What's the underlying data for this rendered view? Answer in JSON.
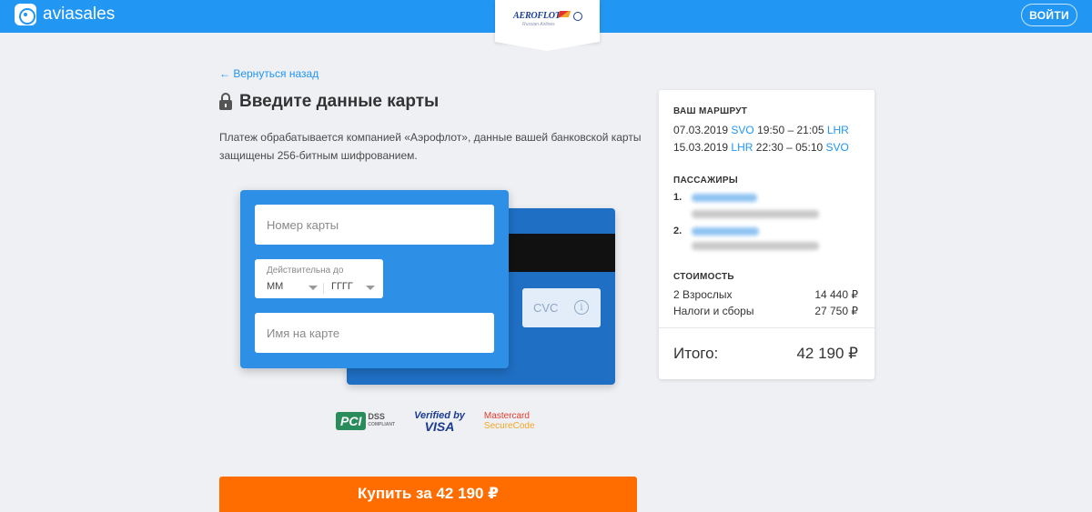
{
  "header": {
    "brand": "aviasales",
    "login_label": "ВОЙТИ",
    "accent_color": "#2196f3",
    "airline": {
      "logo_text": "AEROFLOT",
      "logo_subtext": "Russian Airlines"
    }
  },
  "page": {
    "back_link": "← Вернуться назад",
    "title": "Введите данные карты",
    "description": "Платеж обрабатывается компанией «Аэрофлот», данные вашей банковской карты защищены 256-битным шифрованием."
  },
  "card_form": {
    "card_number_placeholder": "Номер карты",
    "expiry_label": "Действительна до",
    "month_value": "ММ",
    "year_value": "ГГГГ",
    "name_placeholder": "Имя на карте",
    "cvc_placeholder": "CVC",
    "info_icon": "info-icon"
  },
  "security_logos": {
    "pci": "PCI",
    "pci_dss": "DSS",
    "pci_compliant": "COMPLIANT",
    "visa_verified": "Verified by",
    "visa_brand": "VISA",
    "mastercard_line1": "Mastercard",
    "mastercard_line2": "SecureCode"
  },
  "buy_button": {
    "label": "Купить за 42 190 ₽",
    "color": "#ff6d00"
  },
  "summary": {
    "route_heading": "ВАШ МАРШРУТ",
    "routes": [
      {
        "date": "07.03.2019",
        "from": "SVO",
        "times": "19:50 – 21:05",
        "to": "LHR"
      },
      {
        "date": "15.03.2019",
        "from": "LHR",
        "times": "22:30 – 05:10",
        "to": "SVO"
      }
    ],
    "passengers_heading": "ПАССАЖИРЫ",
    "passengers": [
      {
        "num": "1."
      },
      {
        "num": "2."
      }
    ],
    "cost_heading": "СТОИМОСТЬ",
    "costs": [
      {
        "label": "2 Взрослых",
        "value": "14 440 ₽"
      },
      {
        "label": "Налоги и сборы",
        "value": "27 750 ₽"
      }
    ],
    "total_label": "Итого:",
    "total_value": "42 190 ₽"
  }
}
